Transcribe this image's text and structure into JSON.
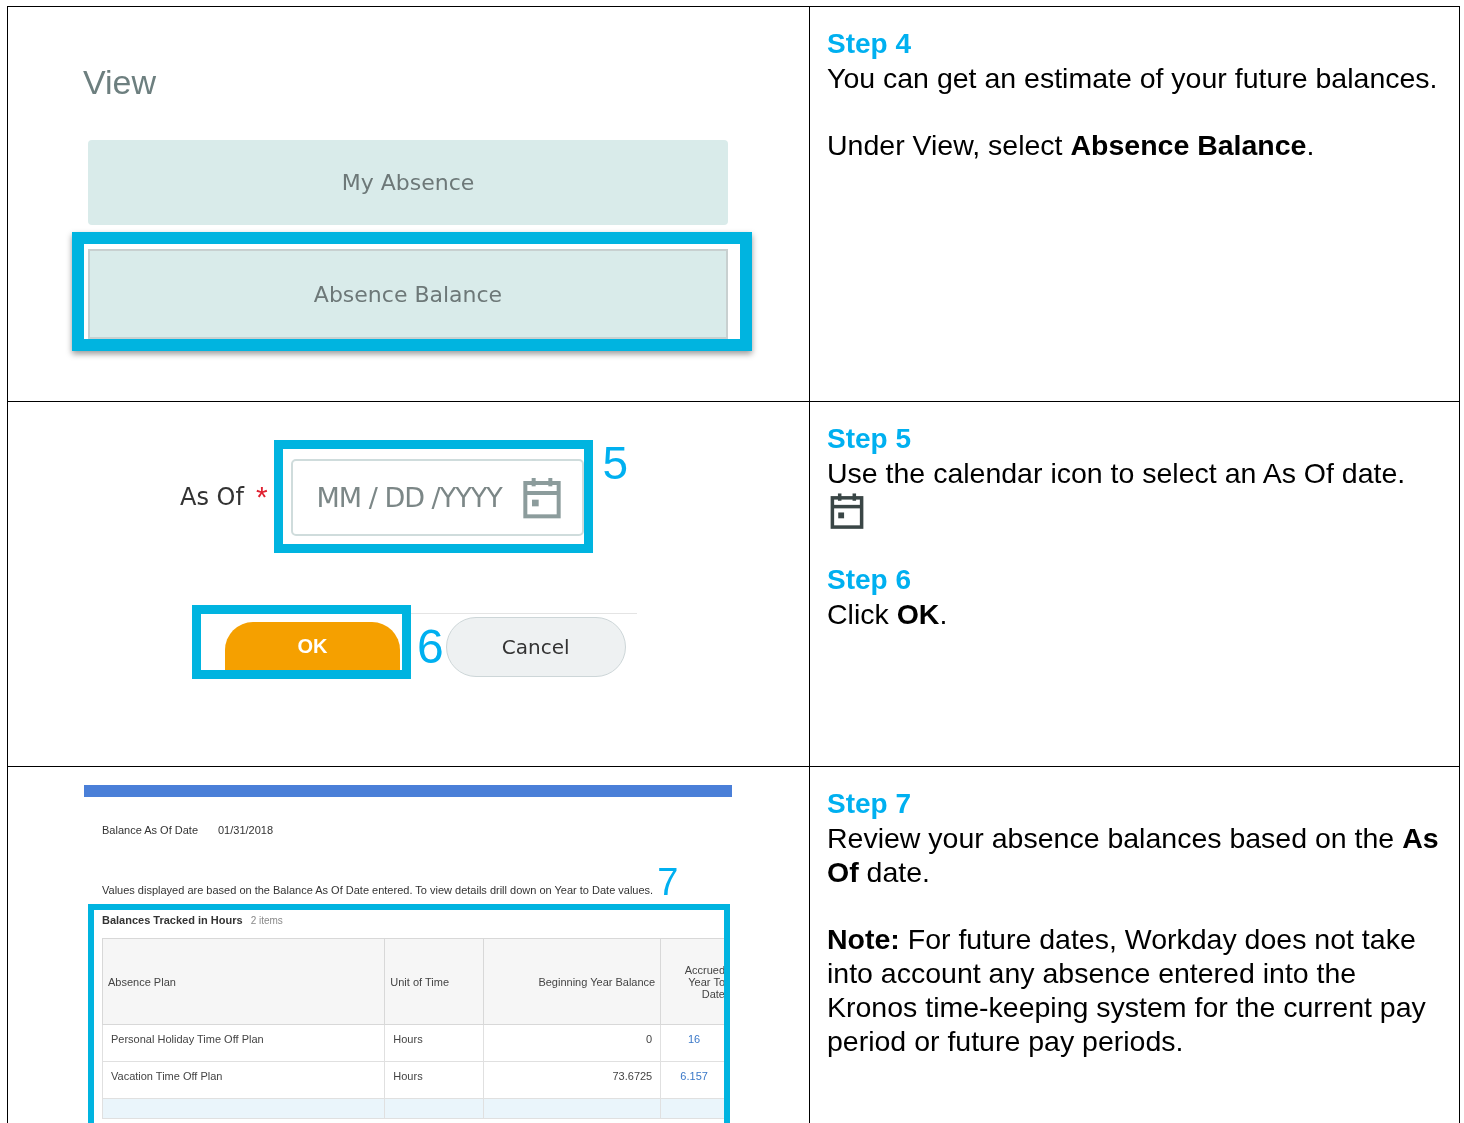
{
  "rows": [
    {
      "left": {
        "kind": "view_menu",
        "title": "View",
        "buttons": [
          {
            "label": "My Absence",
            "highlighted": false
          },
          {
            "label": "Absence Balance",
            "highlighted": true
          }
        ]
      },
      "right": [
        {
          "kind": "heading",
          "text": "Step 4"
        },
        {
          "kind": "text",
          "text": "You can get an estimate of your future balances."
        },
        {
          "kind": "gap"
        },
        {
          "kind": "text",
          "text": "Under View, select **Absence Balance**."
        }
      ]
    },
    {
      "left": {
        "kind": "date_prompt",
        "label": "As Of",
        "required_mark": "*",
        "field": {
          "placeholder": "MM / DD /YYYY",
          "highlighted": true
        },
        "field_callout": "5",
        "ok": {
          "label": "OK",
          "highlighted": true
        },
        "ok_callout": "6",
        "cancel": {
          "label": "Cancel"
        }
      },
      "right": [
        {
          "kind": "heading",
          "text": "Step 5"
        },
        {
          "kind": "text",
          "text": "Use the calendar icon to select an As Of date."
        },
        {
          "kind": "icon"
        },
        {
          "kind": "gap"
        },
        {
          "kind": "heading",
          "text": "Step 6"
        },
        {
          "kind": "text",
          "text": "Click **OK**."
        }
      ]
    },
    {
      "left": {
        "kind": "balance_report",
        "as_of_label": "Balance As Of Date",
        "as_of_value": "01/31/2018",
        "note": "Values displayed are based on the Balance As Of Date entered.  To view details drill down on Year to Date values.",
        "callout": "7",
        "table": {
          "highlighted": true,
          "title": "Balances Tracked in Hours",
          "count": "2 items",
          "columns": [
            "Absence Plan",
            "Unit of Time",
            "Beginning Year Balance",
            "Accrued Year To Date"
          ],
          "rows": [
            [
              "Personal Holiday Time Off Plan",
              "Hours",
              "0",
              "16"
            ],
            [
              "Vacation Time Off Plan",
              "Hours",
              "73.6725",
              "6.157"
            ]
          ]
        }
      },
      "right": [
        {
          "kind": "heading",
          "text": "Step 7"
        },
        {
          "kind": "text",
          "text": "Review your absence balances based on the **As Of** date."
        },
        {
          "kind": "gap"
        },
        {
          "kind": "text",
          "text": "**Note:** For future dates, Workday does not take into account any absence entered into the Kronos time-keeping system for the current pay period or future pay periods."
        }
      ]
    }
  ]
}
